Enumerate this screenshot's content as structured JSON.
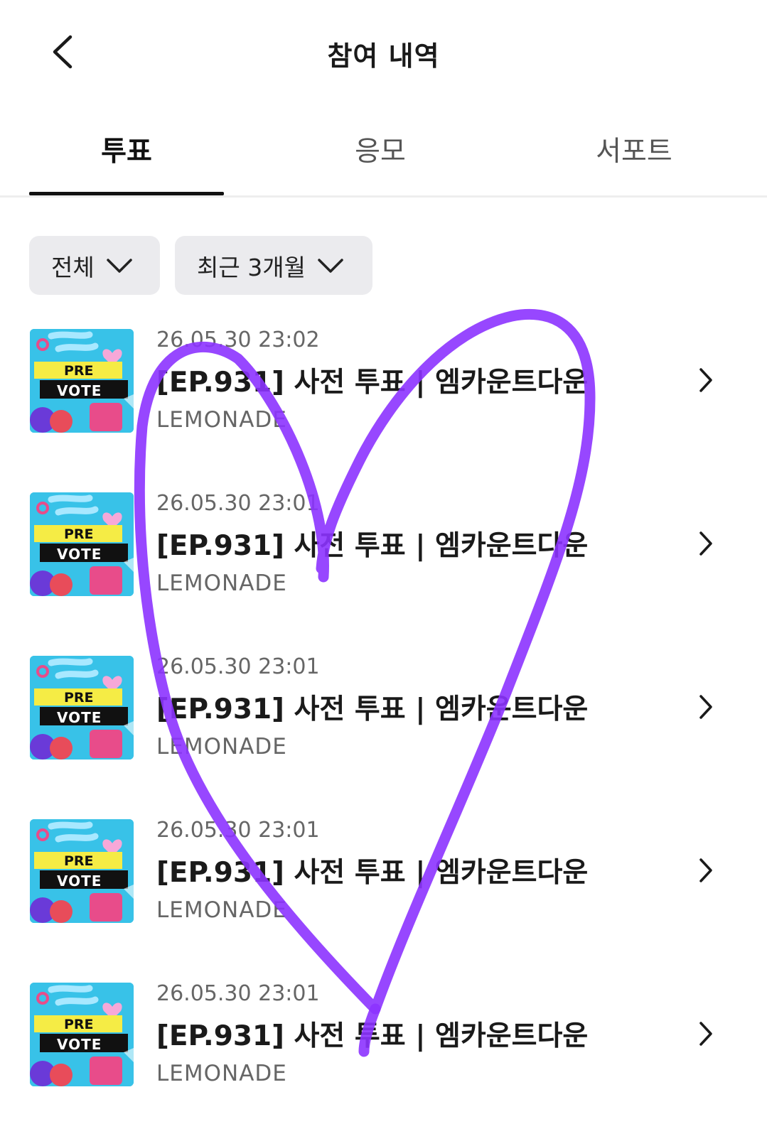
{
  "header": {
    "title": "참여 내역",
    "back_icon": "chevron-left-icon"
  },
  "tabs": [
    {
      "label": "투표",
      "active": true
    },
    {
      "label": "응모",
      "active": false
    },
    {
      "label": "서포트",
      "active": false
    }
  ],
  "filters": [
    {
      "label": "전체",
      "icon": "chevron-down-icon"
    },
    {
      "label": "최근 3개월",
      "icon": "chevron-down-icon"
    }
  ],
  "thumbnail": {
    "line1": "PRE",
    "line2": "VOTE"
  },
  "items": [
    {
      "date": "26.05.30 23:02",
      "title": "[EP.931] 사전 투표 | 엠카운트다운",
      "brand": "LEMONADE"
    },
    {
      "date": "26.05.30 23:01",
      "title": "[EP.931] 사전 투표 | 엠카운트다운",
      "brand": "LEMONADE"
    },
    {
      "date": "26.05.30 23:01",
      "title": "[EP.931] 사전 투표 | 엠카운트다운",
      "brand": "LEMONADE"
    },
    {
      "date": "26.05.30 23:01",
      "title": "[EP.931] 사전 투표 | 엠카운트다운",
      "brand": "LEMONADE"
    },
    {
      "date": "26.05.30 23:01",
      "title": "[EP.931] 사전 투표 | 엠카운트다운",
      "brand": "LEMONADE"
    }
  ],
  "colors": {
    "heart_stroke": "#8c33ff",
    "thumb_bg": "#38c2e8",
    "thumb_band": "#f5ec45"
  }
}
